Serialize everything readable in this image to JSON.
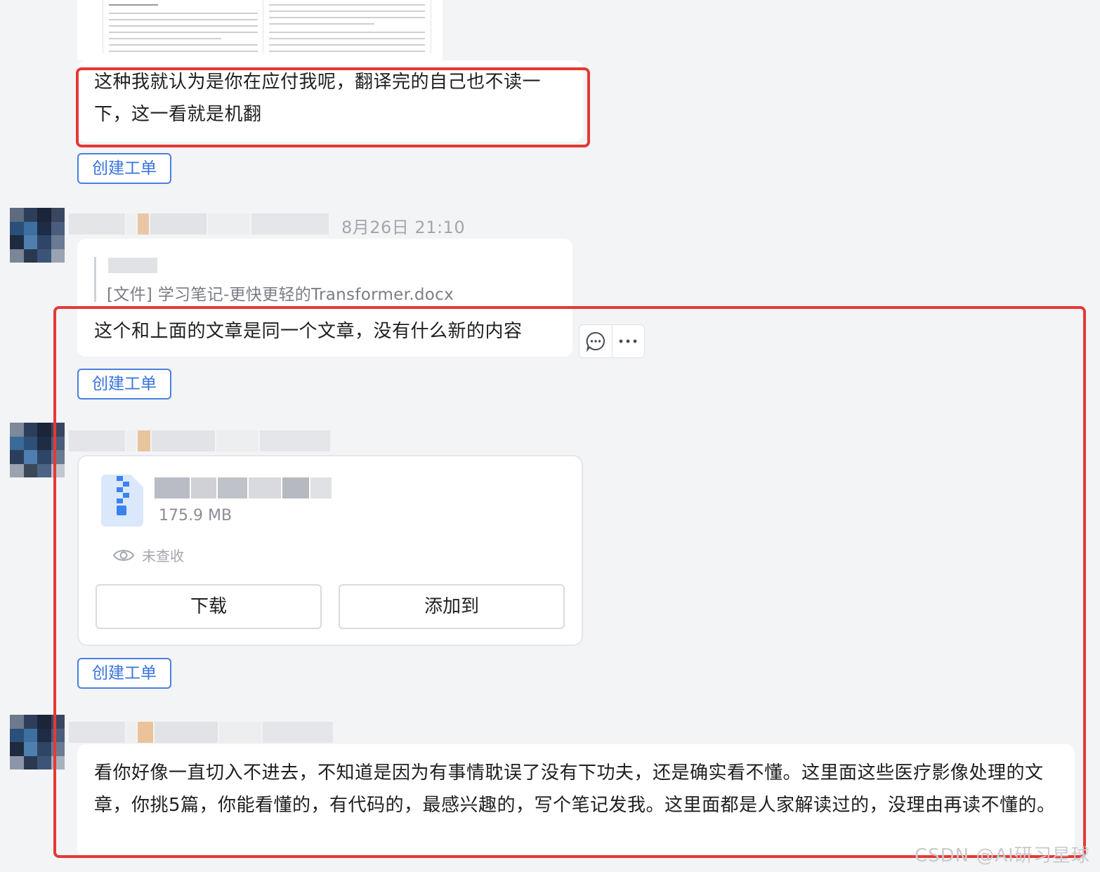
{
  "messages": [
    {
      "text": "这种我就认为是你在应付我呢，翻译完的自己也不读一下，这一看就是机翻",
      "ticket_label": "创建工单"
    },
    {
      "timestamp": "8月26日 21:10",
      "quote_file": "[文件] 学习笔记-更快更轻的Transformer.docx",
      "text": "这个和上面的文章是同一个文章，没有什么新的内容",
      "ticket_label": "创建工单",
      "actions": [
        "reply-icon",
        "more-icon"
      ]
    },
    {
      "file": {
        "icon": "zip-file-icon",
        "size": "175.9 MB",
        "view_status": "未查收",
        "download_label": "下载",
        "add_to_label": "添加到"
      },
      "ticket_label": "创建工单"
    },
    {
      "text": "看你好像一直切入不进去，不知道是因为有事情耽误了没有下功夫，还是确实看不懂。这里面这些医疗影像处理的文章，你挑5篇，你能看懂的，有代码的，最感兴趣的，写个笔记发我。这里面都是人家解读过的，没理由再读不懂的。"
    }
  ],
  "watermark": "CSDN @AI研习星球",
  "colors": {
    "highlight_red": "#e53935",
    "ticket_blue": "#3a73dd",
    "background": "#f3f4f6"
  }
}
